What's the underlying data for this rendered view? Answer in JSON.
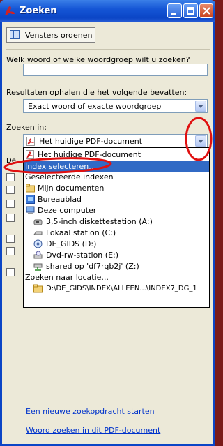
{
  "window": {
    "title": "Zoeken"
  },
  "toolbar": {
    "arrange_label": "Vensters ordenen"
  },
  "search": {
    "question_label": "Welk woord of welke woordgroep wilt u zoeken?",
    "query_value": "",
    "results_label": "Resultaten ophalen die het volgende bevatten:",
    "match_mode": "Exact woord of exacte woordgroep",
    "scope_label": "Zoeken in:",
    "scope_value": "Het huidige PDF-document"
  },
  "dropdown": {
    "items": [
      {
        "label": "Het huidige PDF-document",
        "icon": "pdf-icon"
      },
      {
        "label": "Index selecteren...",
        "icon": "",
        "selected": true
      },
      {
        "label": "Geselecteerde indexen",
        "icon": ""
      },
      {
        "label": "Mijn documenten",
        "icon": "folder-icon"
      },
      {
        "label": "Bureaublad",
        "icon": "desktop-icon"
      },
      {
        "label": "Deze computer",
        "icon": "computer-icon"
      },
      {
        "label": "3,5-inch diskettestation (A:)",
        "icon": "floppy-icon"
      },
      {
        "label": "Lokaal station (C:)",
        "icon": "drive-icon"
      },
      {
        "label": "DE_GIDS (D:)",
        "icon": "cd-drive-icon"
      },
      {
        "label": "Dvd-rw-station (E:)",
        "icon": "dvd-drive-icon"
      },
      {
        "label": "shared op 'df7rqb2j' (Z:)",
        "icon": "network-drive-icon"
      },
      {
        "label": "Zoeken naar locatie...",
        "icon": ""
      },
      {
        "label": "D:\\DE_GIDS\\INDEX\\ALLEEN...\\INDEX7_DG_1",
        "icon": "folder-icon"
      }
    ]
  },
  "hidden_fragments": {
    "de": "De"
  },
  "links": {
    "new_search": "Een nieuwe zoekopdracht starten",
    "find_in_doc": "Woord zoeken in dit PDF-document"
  },
  "colors": {
    "titlebar": "#0b45c6",
    "selection": "#316ac5",
    "annotation": "#e01010",
    "link": "#0033cc"
  }
}
